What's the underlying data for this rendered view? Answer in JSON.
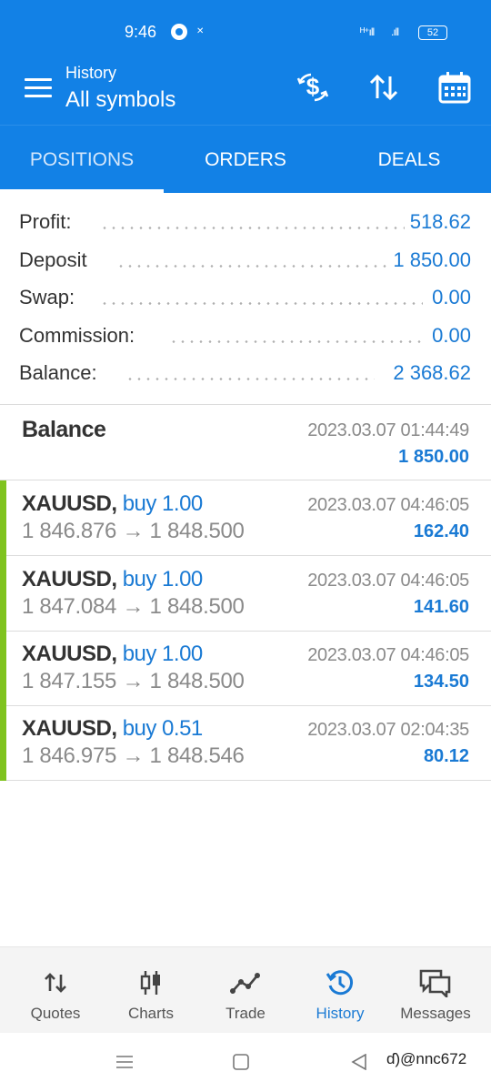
{
  "status_bar": {
    "time": "9:46",
    "battery": "52"
  },
  "app_bar": {
    "subtitle": "History",
    "title": "All symbols"
  },
  "tabs": [
    {
      "label": "POSITIONS",
      "active": true
    },
    {
      "label": "ORDERS",
      "active": false
    },
    {
      "label": "DEALS",
      "active": false
    }
  ],
  "summary": [
    {
      "label": "Profit:",
      "value": "518.62"
    },
    {
      "label": "Deposit",
      "value": "1 850.00"
    },
    {
      "label": "Swap:",
      "value": "0.00"
    },
    {
      "label": "Commission:",
      "value": "0.00"
    },
    {
      "label": "Balance:",
      "value": "2 368.62"
    }
  ],
  "balance_entry": {
    "name": "Balance",
    "time": "2023.03.07 01:44:49",
    "amount": "1 850.00"
  },
  "deals": [
    {
      "symbol": "XAUUSD,",
      "action": "buy 1.00",
      "open": "1 846.876",
      "arrow": "→",
      "close": "1 848.500",
      "time": "2023.03.07 04:46:05",
      "profit": "162.40"
    },
    {
      "symbol": "XAUUSD,",
      "action": "buy 1.00",
      "open": "1 847.084",
      "arrow": "→",
      "close": "1 848.500",
      "time": "2023.03.07 04:46:05",
      "profit": "141.60"
    },
    {
      "symbol": "XAUUSD,",
      "action": "buy 1.00",
      "open": "1 847.155",
      "arrow": "→",
      "close": "1 848.500",
      "time": "2023.03.07 04:46:05",
      "profit": "134.50"
    },
    {
      "symbol": "XAUUSD,",
      "action": "buy 0.51",
      "open": "1 846.975",
      "arrow": "→",
      "close": "1 848.546",
      "time": "2023.03.07 02:04:35",
      "profit": "80.12"
    }
  ],
  "bottom_nav": [
    {
      "label": "Quotes",
      "icon": "quotes-icon",
      "active": false
    },
    {
      "label": "Charts",
      "icon": "charts-icon",
      "active": false
    },
    {
      "label": "Trade",
      "icon": "trade-icon",
      "active": false
    },
    {
      "label": "History",
      "icon": "history-icon",
      "active": true
    },
    {
      "label": "Messages",
      "icon": "messages-icon",
      "active": false
    }
  ],
  "watermark": "ɗ)@nnc672",
  "colors": {
    "primary": "#1281e6",
    "value_blue": "#1a7ad4",
    "buy_bar": "#7fc31f",
    "muted": "#8a8a8a"
  }
}
